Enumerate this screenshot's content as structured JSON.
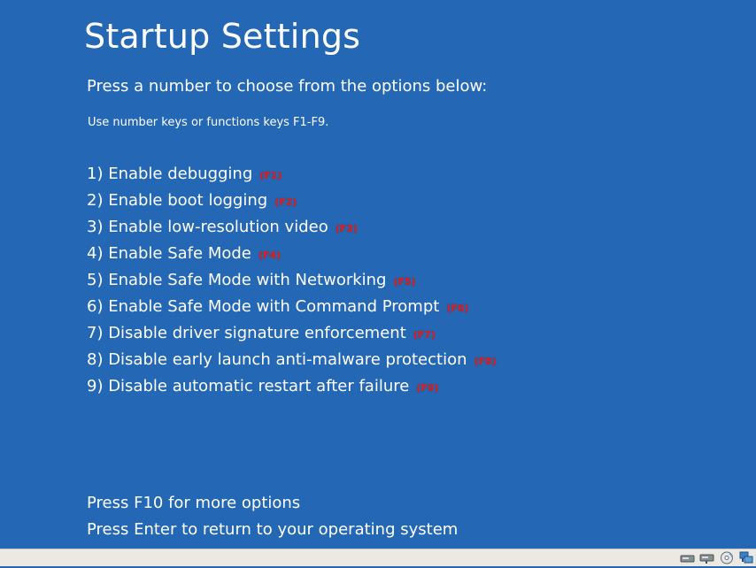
{
  "screen": {
    "title": "Startup Settings",
    "subtitle": "Press a number to choose from the options below:",
    "hint": "Use number keys or functions keys F1-F9."
  },
  "options": [
    {
      "label": "1) Enable debugging",
      "key": "(F1)"
    },
    {
      "label": "2) Enable boot logging",
      "key": "(F2)"
    },
    {
      "label": "3) Enable low-resolution video",
      "key": "(F3)"
    },
    {
      "label": "4) Enable Safe Mode",
      "key": "(F4)"
    },
    {
      "label": "5) Enable Safe Mode with Networking",
      "key": "(F5)"
    },
    {
      "label": "6) Enable Safe Mode with Command Prompt",
      "key": "(F6)"
    },
    {
      "label": "7) Disable driver signature enforcement",
      "key": "(F7)"
    },
    {
      "label": "8) Disable early launch anti-malware protection",
      "key": "(F8)"
    },
    {
      "label": "9) Disable automatic restart after failure",
      "key": "(F9)"
    }
  ],
  "footer": {
    "more_options": "Press F10 for more options",
    "return": "Press Enter to return to your operating system"
  },
  "statusbar": {
    "icons": [
      "hard-disk-icon",
      "network-drive-icon",
      "optical-disc-icon",
      "network-adapter-icon"
    ]
  },
  "colors": {
    "background": "#2467b5",
    "text": "#ffffff",
    "annotation": "#d62424",
    "statusbar": "#ece9e3"
  }
}
